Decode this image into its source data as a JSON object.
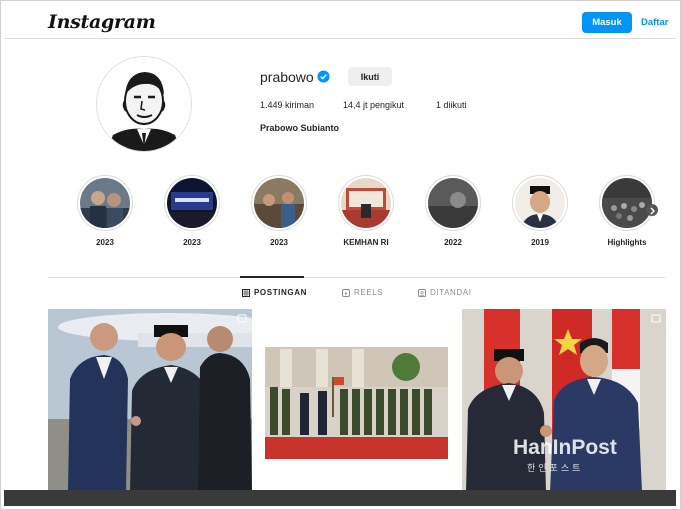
{
  "header": {
    "logo": "Instagram",
    "login_label": "Masuk",
    "signup_label": "Daftar"
  },
  "profile": {
    "username": "prabowo",
    "follow_label": "Ikuti",
    "posts": "1.449 kiriman",
    "followers": "14,4 jt pengikut",
    "following": "1 diikuti",
    "full_name": "Prabowo Subianto"
  },
  "highlights": [
    {
      "label": "2023"
    },
    {
      "label": "2023"
    },
    {
      "label": "2023"
    },
    {
      "label": "KEMHAN RI"
    },
    {
      "label": "2022"
    },
    {
      "label": "2019"
    },
    {
      "label": "Highlights"
    }
  ],
  "tabs": [
    {
      "label": "POSTINGAN"
    },
    {
      "label": "REELS"
    },
    {
      "label": "DITANDAI"
    }
  ],
  "watermark": {
    "line1": "HanInPost",
    "line2": "한인포스트"
  },
  "colors": {
    "accent": "#0095f6",
    "text": "#262626",
    "divider": "#dbdbdb"
  }
}
